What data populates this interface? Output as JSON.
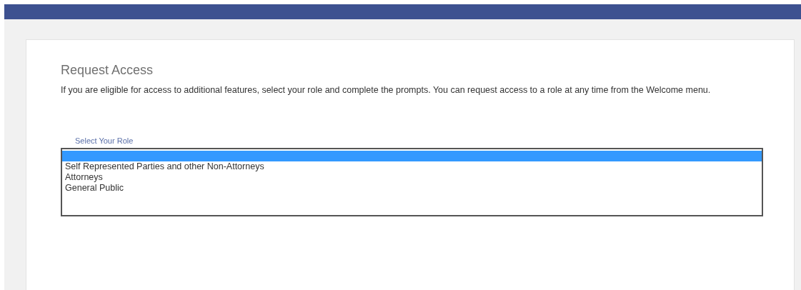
{
  "title": "Request Access",
  "intro": "If you are eligible for access to additional features, select your role and complete the prompts. You can request access to a role at any time from the Welcome menu.",
  "role_field": {
    "label": "Select Your Role",
    "options": [
      {
        "selected": true
      },
      {
        "label": "Self Represented Parties and other Non-Attorneys",
        "selected": false
      },
      {
        "label": "Attorneys",
        "selected": false
      },
      {
        "label": "General Public",
        "selected": false
      }
    ]
  }
}
